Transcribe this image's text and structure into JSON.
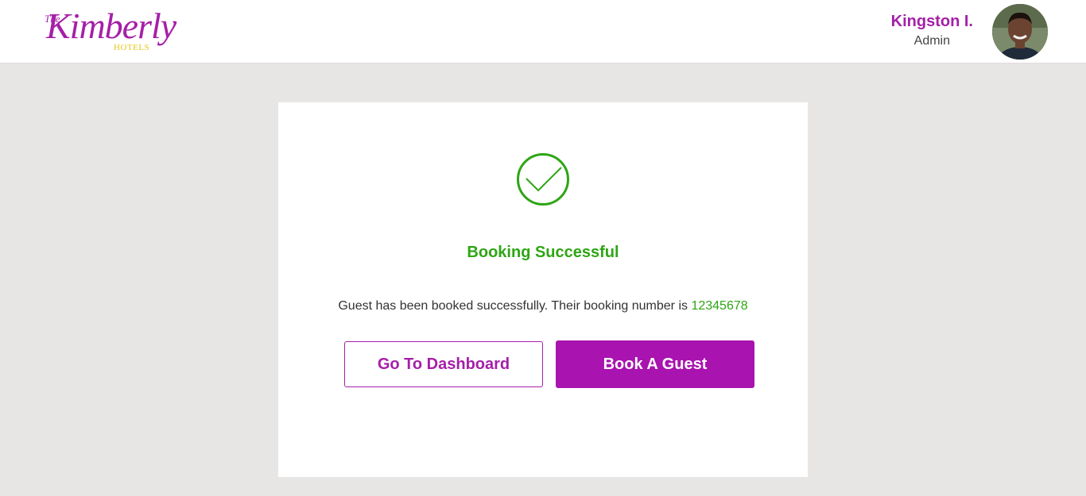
{
  "header": {
    "logo": {
      "the": "The",
      "name": "Kimberly",
      "sub": "HOTELS"
    },
    "user": {
      "name": "Kingston I.",
      "role": "Admin",
      "avatar_icon": "user-avatar-photo"
    }
  },
  "card": {
    "icon": "check-circle-icon",
    "title": "Booking Successful",
    "message": "Guest has been booked successfully. Their booking number is ",
    "booking_number": "12345678",
    "buttons": {
      "dashboard": "Go To Dashboard",
      "book": "Book A Guest"
    }
  },
  "colors": {
    "brand": "#a51fa8",
    "success": "#2ea514",
    "background": "#e8e5e5"
  }
}
